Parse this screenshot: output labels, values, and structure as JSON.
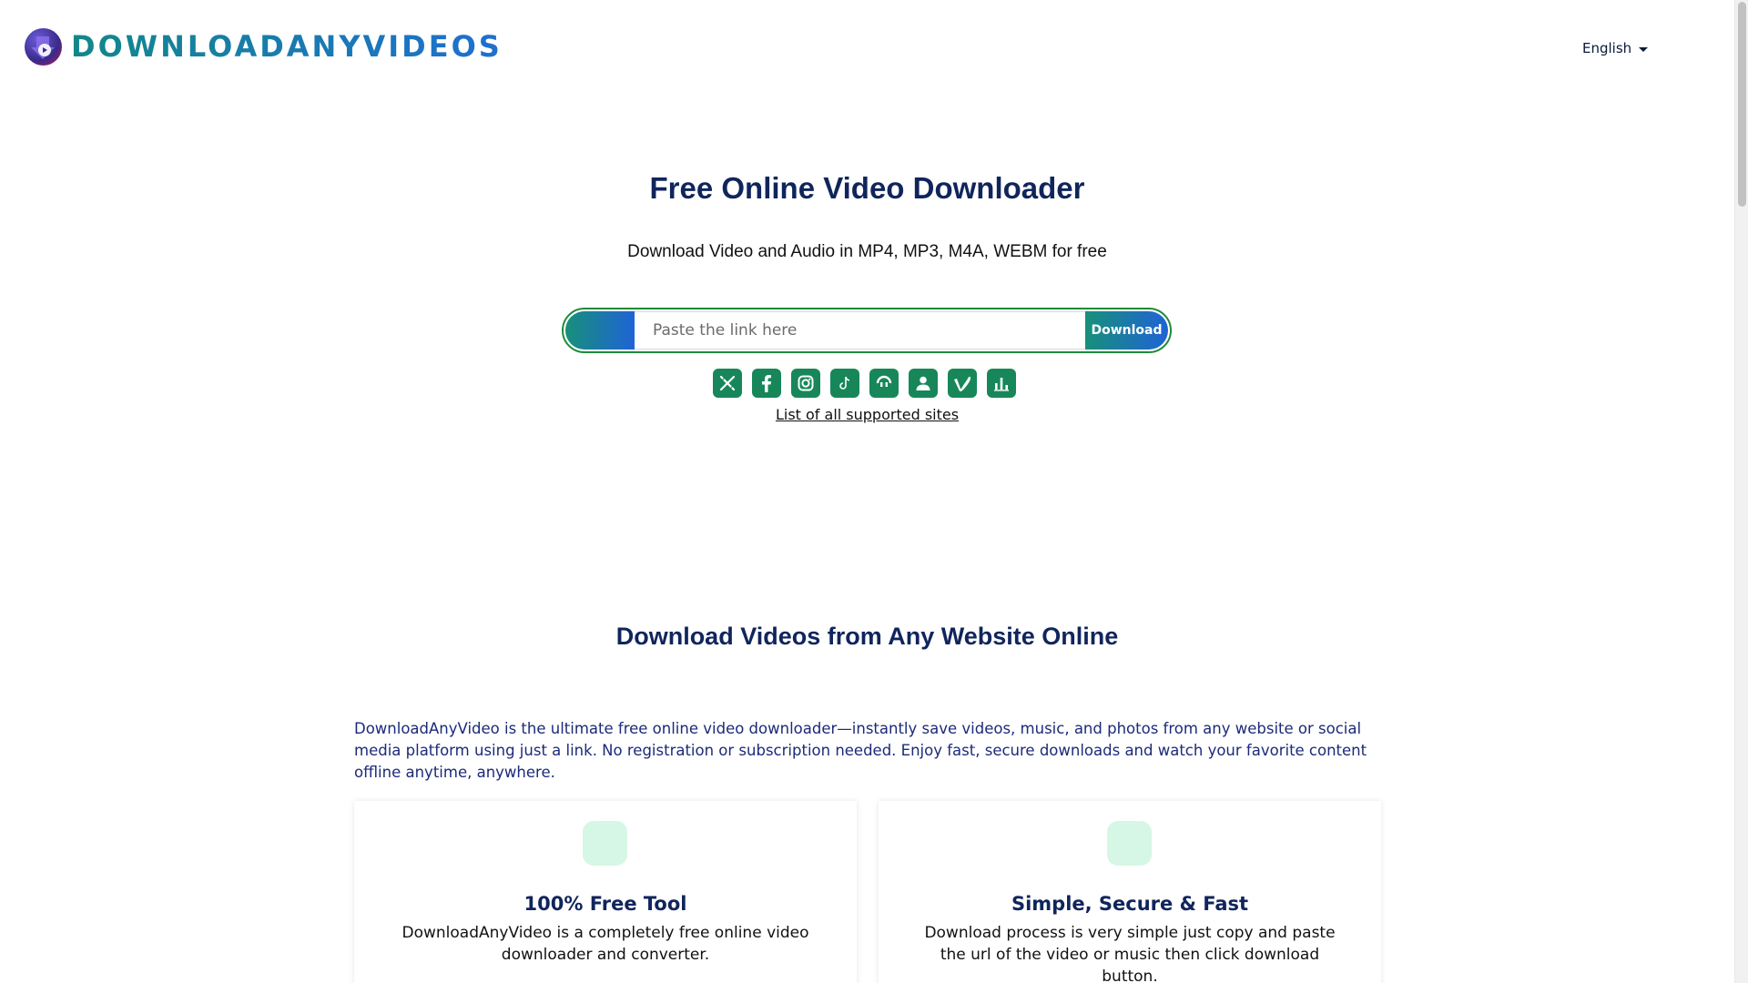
{
  "header": {
    "logo_text": "DOWNLOADANYVIDEOS",
    "language": "English"
  },
  "hero": {
    "title": "Free Online Video Downloader",
    "subtitle": "Download Video and Audio in MP4, MP3, M4A, WEBM for free",
    "search_placeholder": "Paste the link here",
    "download_label": "Download",
    "supported_sites_link": "List of all supported sites"
  },
  "site_icons": [
    "x-icon",
    "facebook-icon",
    "instagram-icon",
    "tiktok-icon",
    "soundcloud-icon",
    "user-icon",
    "vimeo-icon",
    "chart-icon"
  ],
  "section": {
    "title": "Download Videos from Any Website Online",
    "description": "DownloadAnyVideo is the ultimate free online video downloader—instantly save videos, music, and photos from any website or social media platform using just a link. No registration or subscription needed. Enjoy fast, secure downloads and watch your favorite content offline anytime, anywhere."
  },
  "features": [
    {
      "title": "100% Free Tool",
      "text": "DownloadAnyVideo is a completely free online video downloader and converter."
    },
    {
      "title": "Simple, Secure & Fast",
      "text": "Download process is very simple just copy and paste the url of the video or music then click download button."
    }
  ],
  "colors": {
    "brand_teal": "#13878a",
    "brand_blue": "#1f6fd1",
    "icon_green": "#17875a",
    "heading_navy": "#10255c",
    "feature_icon_bg": "#d6f7e5"
  }
}
